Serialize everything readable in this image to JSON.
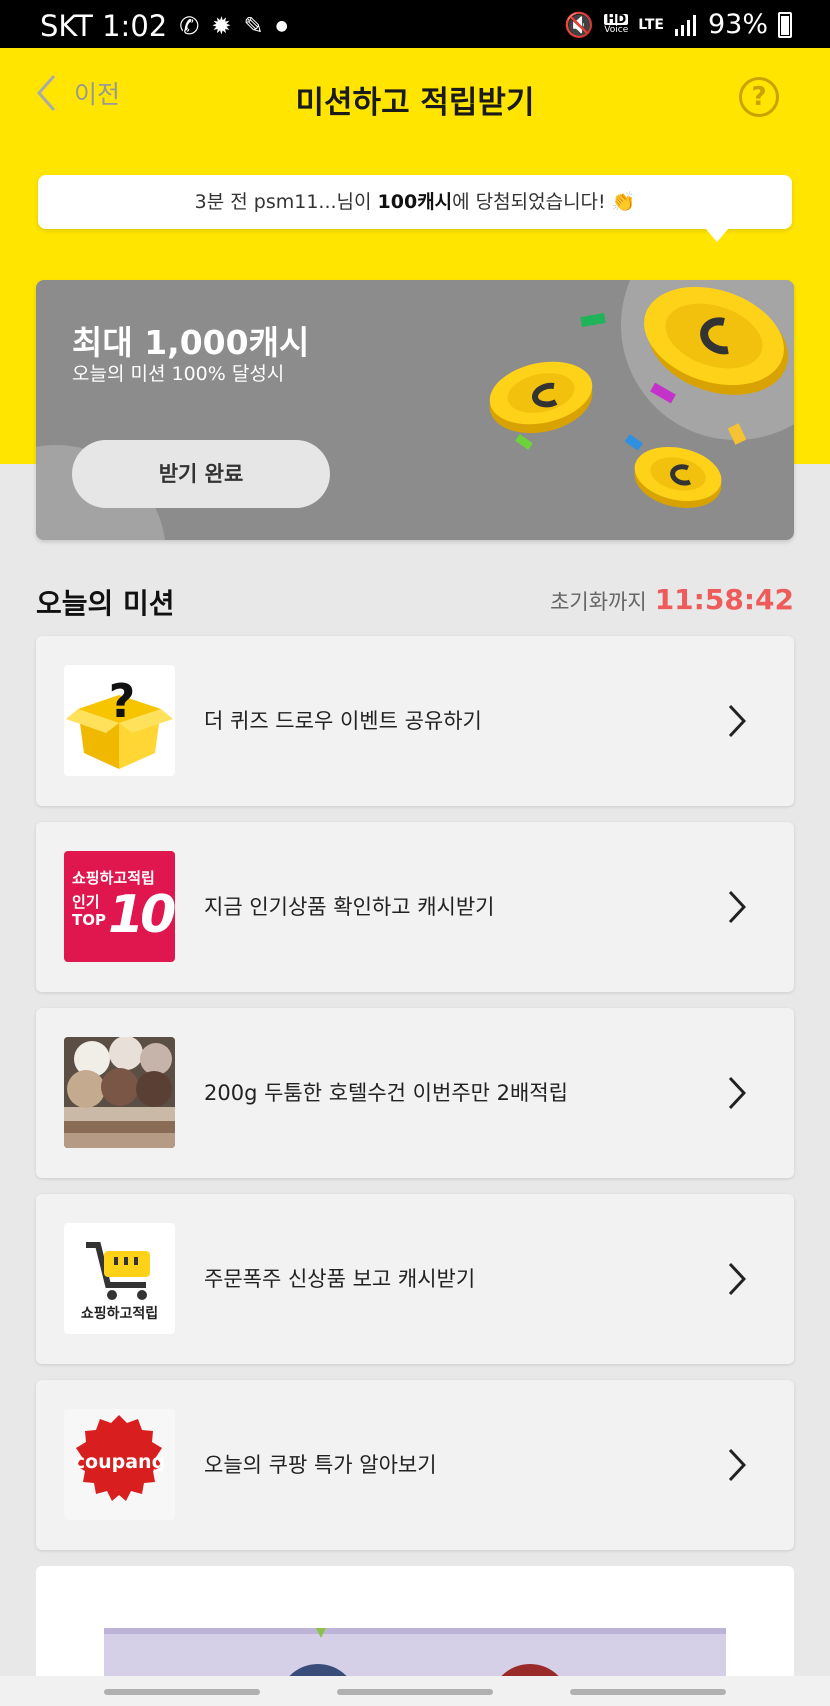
{
  "status_bar": {
    "carrier_time": "SKT 1:02",
    "battery": "93%",
    "net_label_top": "HD",
    "net_label_bottom": "Voice",
    "lte": "LTE"
  },
  "header": {
    "back_label": "이전",
    "title": "미션하고 적립받기",
    "help_icon": "?"
  },
  "notice": {
    "prefix": "3분 전 psm11...님이 ",
    "amount": "100캐시",
    "suffix": "에 당첨되었습니다! 👏"
  },
  "reward": {
    "title": "최대 1,000캐시",
    "subtitle": "오늘의 미션 100% 달성시",
    "button_label": "받기 완료"
  },
  "missions": {
    "title": "오늘의 미션",
    "reset_label": "초기화까지",
    "reset_time": "11:58:42",
    "items": [
      {
        "label": "더 퀴즈 드로우 이벤트 공유하기",
        "icon": "mystery-box-icon"
      },
      {
        "label": "지금 인기상품 확인하고 캐시받기",
        "icon": "top10-badge",
        "badge_line1": "쇼핑하고적립",
        "badge_line2": "인기",
        "badge_line3": "TOP",
        "badge_num": "10"
      },
      {
        "label": "200g 두툼한 호텔수건 이번주만 2배적립",
        "icon": "towels-photo"
      },
      {
        "label": "주문폭주 신상품 보고 캐시받기",
        "icon": "shopping-cart-icon",
        "badge_text": "쇼핑하고적립"
      },
      {
        "label": "오늘의 쿠팡 특가 알아보기",
        "icon": "coupang-badge",
        "badge_text": "coupang"
      }
    ]
  },
  "colors": {
    "brand_yellow": "#ffe500",
    "timer_red": "#ef5b5b",
    "card_gray": "#8c8c8c",
    "top10_red": "#e0174f"
  }
}
